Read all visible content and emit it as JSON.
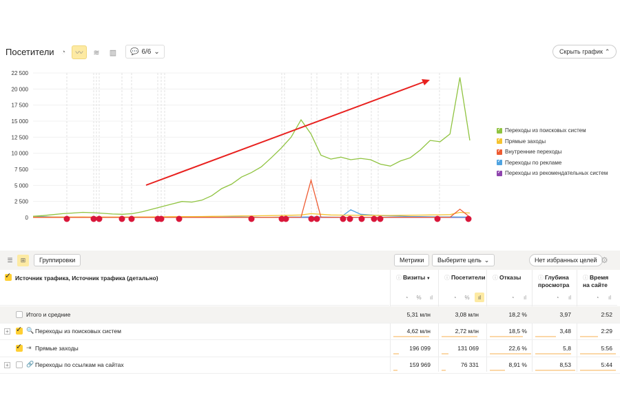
{
  "header": {
    "title": "Посетители",
    "comments_count": "6/6",
    "hide_chart": "Скрыть график"
  },
  "chart_data": {
    "type": "line",
    "ylim": [
      0,
      22500
    ],
    "yticks": [
      "22 500",
      "20 000",
      "17 500",
      "15 000",
      "12 500",
      "10 000",
      "7 500",
      "5 000",
      "2 500",
      "0"
    ],
    "series": [
      {
        "name": "Переходы из поисковых систем",
        "color": "#8fc33f",
        "values": [
          200,
          300,
          450,
          600,
          700,
          800,
          750,
          650,
          550,
          500,
          600,
          900,
          1300,
          1700,
          2100,
          2500,
          2400,
          2700,
          3400,
          4500,
          5200,
          6300,
          7000,
          7900,
          9300,
          10800,
          12500,
          15200,
          13000,
          9700,
          9100,
          9400,
          9000,
          9200,
          9000,
          8300,
          8000,
          8800,
          9300,
          10500,
          12000,
          11800,
          13000,
          21800,
          12000
        ]
      },
      {
        "name": "Прямые заходы",
        "color": "#f4c330",
        "values": [
          60,
          60,
          70,
          80,
          80,
          90,
          80,
          70,
          70,
          70,
          80,
          90,
          100,
          120,
          130,
          150,
          150,
          160,
          180,
          200,
          220,
          250,
          260,
          280,
          300,
          330,
          350,
          400,
          600,
          500,
          400,
          380,
          360,
          350,
          340,
          330,
          320,
          340,
          350,
          380,
          400,
          420,
          450,
          800,
          700
        ]
      },
      {
        "name": "Внутренние переходы",
        "color": "#ee5b32",
        "values": [
          20,
          20,
          20,
          20,
          20,
          20,
          20,
          20,
          20,
          20,
          20,
          20,
          20,
          20,
          20,
          20,
          20,
          20,
          20,
          20,
          20,
          20,
          20,
          20,
          20,
          30,
          40,
          50,
          5800,
          50,
          40,
          40,
          40,
          40,
          40,
          40,
          40,
          40,
          40,
          40,
          40,
          40,
          40,
          1300,
          60
        ]
      },
      {
        "name": "Переходы по рекламе",
        "color": "#4fa3e0",
        "values": [
          200,
          150,
          100,
          60,
          50,
          40,
          40,
          40,
          40,
          40,
          40,
          40,
          40,
          40,
          40,
          40,
          40,
          40,
          40,
          60,
          80,
          80,
          60,
          40,
          40,
          60,
          80,
          80,
          100,
          80,
          60,
          50,
          1200,
          500,
          400,
          300,
          250,
          200,
          150,
          150,
          120,
          100,
          100,
          80,
          60
        ]
      },
      {
        "name": "Переходы из рекомендательных систем",
        "color": "#8e44ad",
        "values": [
          10,
          10,
          10,
          10,
          10,
          10,
          10,
          10,
          10,
          10,
          10,
          10,
          10,
          10,
          10,
          10,
          10,
          10,
          10,
          10,
          10,
          10,
          10,
          10,
          10,
          10,
          10,
          10,
          10,
          10,
          10,
          10,
          10,
          10,
          10,
          10,
          10,
          10,
          10,
          10,
          10,
          10,
          10,
          10,
          10
        ]
      }
    ]
  },
  "toolbar": {
    "groups": "Группировки",
    "metrics": "Метрики",
    "goal": "Выберите цель",
    "favorites": "Нет избранных целей"
  },
  "table": {
    "dimension_header": "Источник трафика, Источник трафика (детально)",
    "columns": [
      {
        "label": "Визиты",
        "sort": "▼"
      },
      {
        "label": "Посетители"
      },
      {
        "label": "Отказы"
      },
      {
        "label": "Глубина просмотра"
      },
      {
        "label": "Время на сайте"
      }
    ],
    "rows": [
      {
        "label": "Итого и средние",
        "values": [
          "5,31 млн",
          "3,08 млн",
          "18,2 %",
          "3,97",
          "2:52"
        ]
      },
      {
        "label": "Переходы из поисковых систем",
        "values": [
          "4,62 млн",
          "2,72 млн",
          "18,5 %",
          "3,48",
          "2:29"
        ]
      },
      {
        "label": "Прямые заходы",
        "values": [
          "196 099",
          "131 069",
          "22,6 %",
          "5,8",
          "5:56"
        ]
      },
      {
        "label": "Переходы по ссылкам на сайтах",
        "values": [
          "159 969",
          "76 331",
          "8,91 %",
          "8,53",
          "5:44"
        ]
      }
    ]
  }
}
